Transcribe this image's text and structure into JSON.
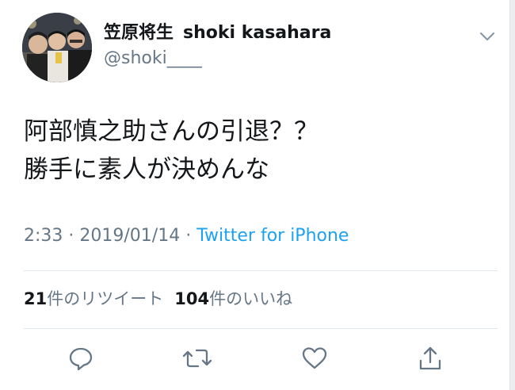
{
  "user": {
    "display_name_jp": "笠原将生",
    "display_name_en": "shoki kasahara",
    "handle": "@shoki____"
  },
  "tweet": {
    "lines": [
      "阿部慎之助さんの引退？？",
      "勝手に素人が決めんな"
    ],
    "time": "2:33",
    "separator": "·",
    "date": "2019/01/14",
    "source": "Twitter for iPhone"
  },
  "stats": {
    "retweet_count": "21",
    "retweet_label": "件のリツイート",
    "like_count": "104",
    "like_label": "件のいいね"
  },
  "actions": [
    "reply-icon",
    "retweet-icon",
    "like-icon",
    "share-icon"
  ],
  "colors": {
    "text": "#14171a",
    "secondary": "#657786",
    "link": "#1da1f2",
    "divider": "#e1e8ed"
  }
}
